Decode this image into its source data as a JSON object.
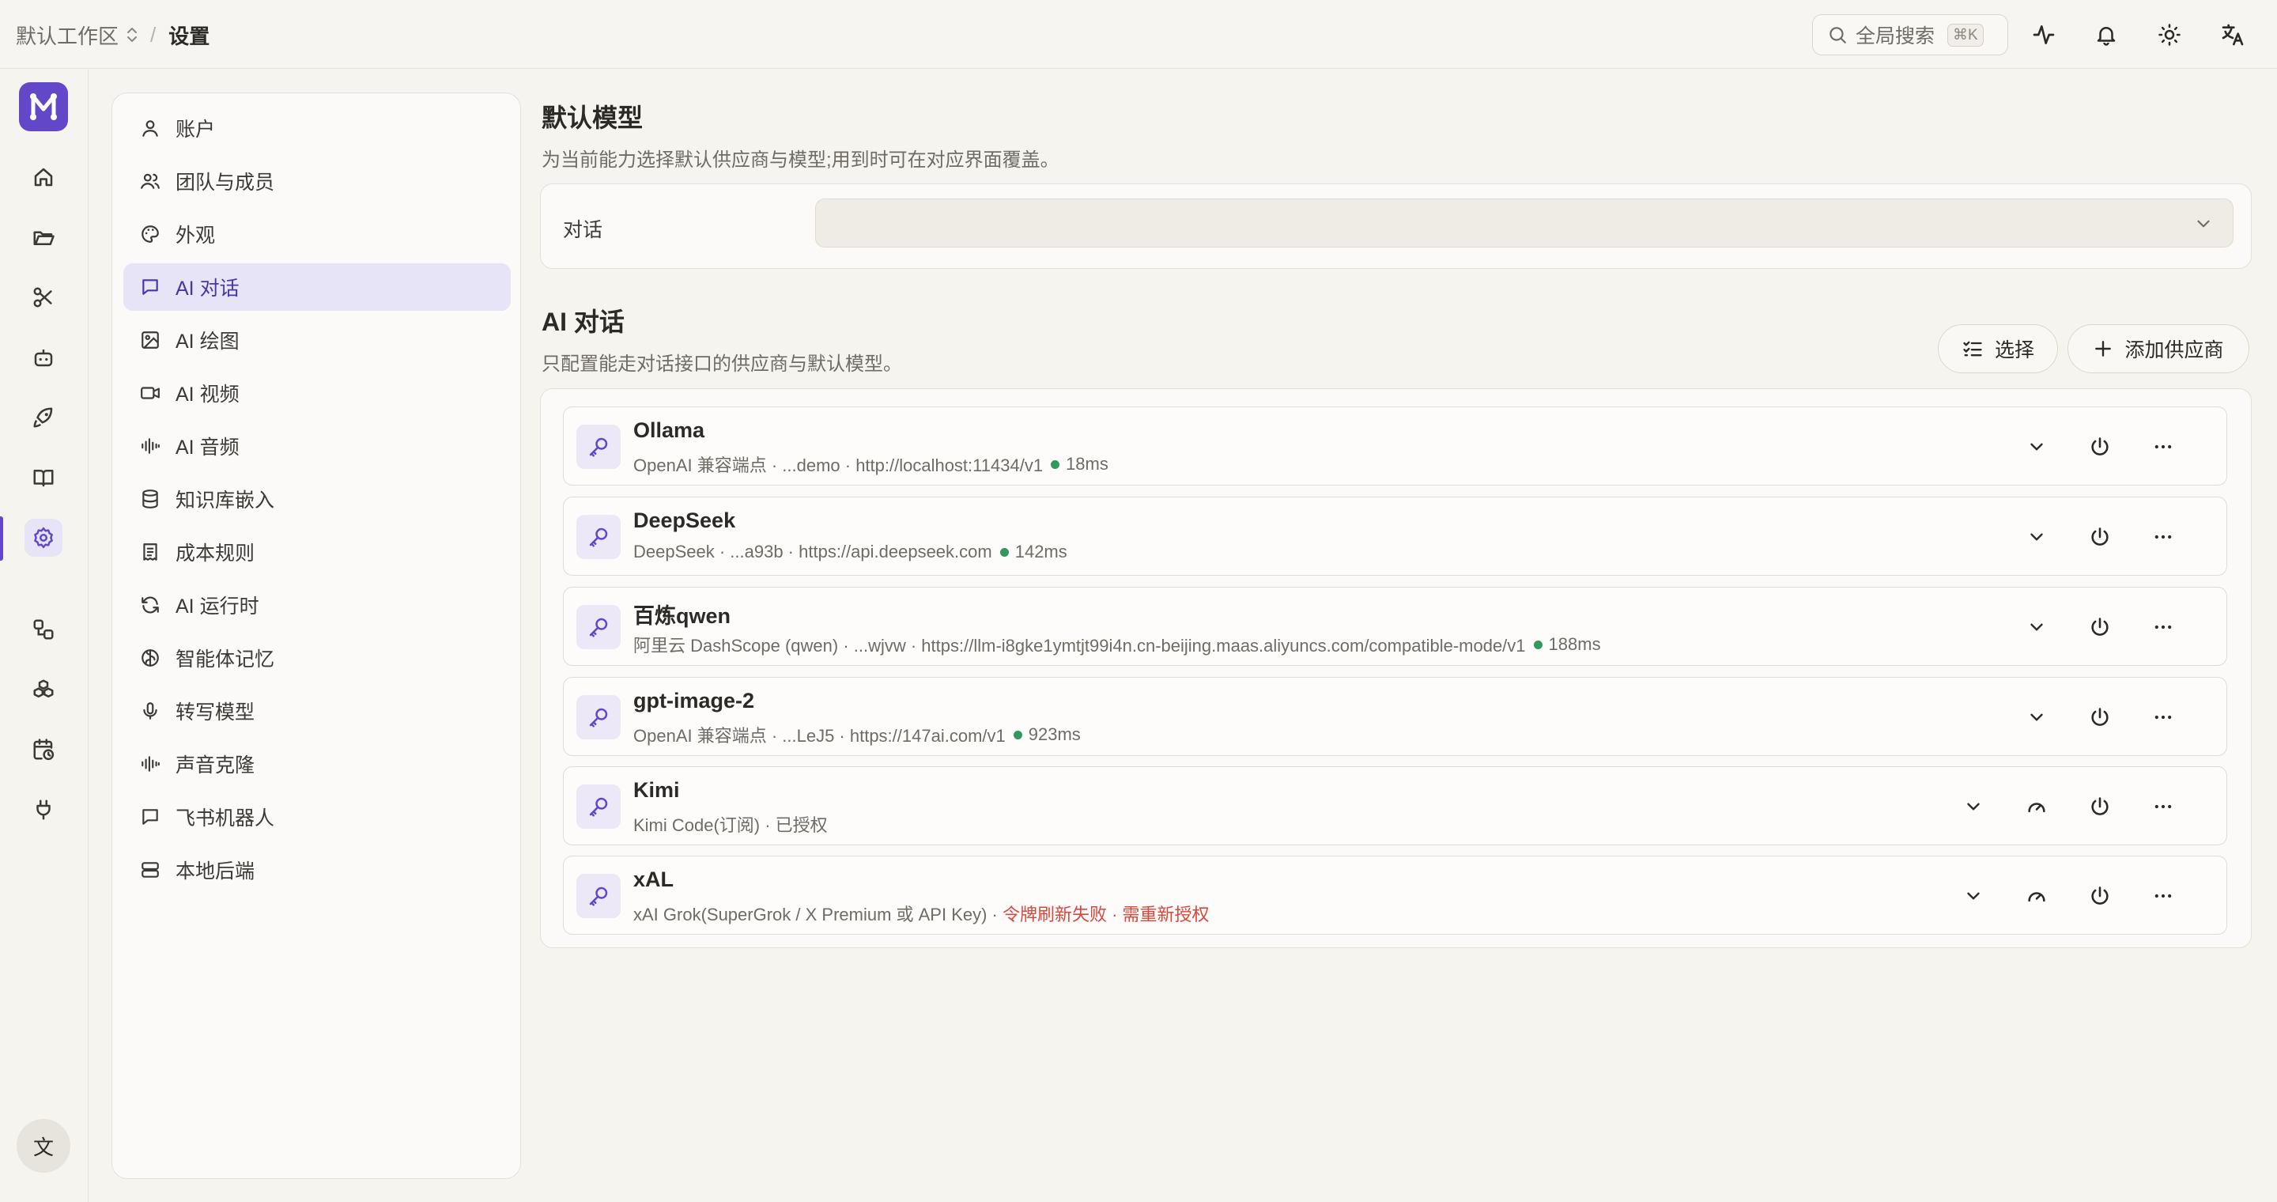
{
  "header": {
    "workspace": "默认工作区",
    "separator": "/",
    "current": "设置",
    "search_label": "全局搜索",
    "search_shortcut": "⌘K"
  },
  "rail": {
    "logo": "M",
    "avatar_label": "文",
    "active_index": 6
  },
  "sidebar": {
    "items": [
      {
        "label": "账户",
        "icon": "user-icon"
      },
      {
        "label": "团队与成员",
        "icon": "users-icon"
      },
      {
        "label": "外观",
        "icon": "palette-icon"
      },
      {
        "label": "AI 对话",
        "icon": "chat-icon"
      },
      {
        "label": "AI 绘图",
        "icon": "image-icon"
      },
      {
        "label": "AI 视频",
        "icon": "video-icon"
      },
      {
        "label": "AI 音频",
        "icon": "audio-wave-icon"
      },
      {
        "label": "知识库嵌入",
        "icon": "database-icon"
      },
      {
        "label": "成本规则",
        "icon": "receipt-icon"
      },
      {
        "label": "AI 运行时",
        "icon": "refresh-icon"
      },
      {
        "label": "智能体记忆",
        "icon": "brain-icon"
      },
      {
        "label": "转写模型",
        "icon": "mic-icon"
      },
      {
        "label": "声音克隆",
        "icon": "audio-wave-icon"
      },
      {
        "label": "飞书机器人",
        "icon": "chat-icon"
      },
      {
        "label": "本地后端",
        "icon": "server-icon"
      }
    ],
    "active": "AI 对话"
  },
  "default_model": {
    "title": "默认模型",
    "subtitle": "为当前能力选择默认供应商与模型;用到时可在对应界面覆盖。",
    "row_label": "对话",
    "select_value": ""
  },
  "ai_chat": {
    "title": "AI 对话",
    "subtitle": "只配置能走对话接口的供应商与默认模型。",
    "select_button": "选择",
    "add_button": "添加供应商",
    "providers": [
      {
        "name": "Ollama",
        "meta": "OpenAI 兼容端点 · ...demo · http://localhost:11434/v1",
        "latency": "18ms",
        "status": "",
        "gauge": false
      },
      {
        "name": "DeepSeek",
        "meta": "DeepSeek · ...a93b · https://api.deepseek.com",
        "latency": "142ms",
        "status": "",
        "gauge": false
      },
      {
        "name": "百炼qwen",
        "meta": "阿里云 DashScope (qwen) · ...wjvw · https://llm-i8gke1ymtjt99i4n.cn-beijing.maas.aliyuncs.com/compatible-mode/v1",
        "latency": "188ms",
        "status": "",
        "gauge": false
      },
      {
        "name": "gpt-image-2",
        "meta": "OpenAI 兼容端点 · ...LeJ5 · https://147ai.com/v1",
        "latency": "923ms",
        "status": "",
        "gauge": false
      },
      {
        "name": "Kimi",
        "meta": "Kimi Code(订阅) · 已授权",
        "latency": "",
        "status": "",
        "gauge": true
      },
      {
        "name": "xAL",
        "meta": "xAI Grok(SuperGrok / X Premium 或 API Key) · ",
        "latency": "",
        "status": "令牌刷新失败 · 需重新授权",
        "gauge": true
      }
    ]
  },
  "colors": {
    "accent": "#6248c8",
    "accent_bg": "#e8e4f7",
    "ok": "#2f9a5c",
    "error": "#d9473b",
    "background": "#f6f4ef"
  }
}
